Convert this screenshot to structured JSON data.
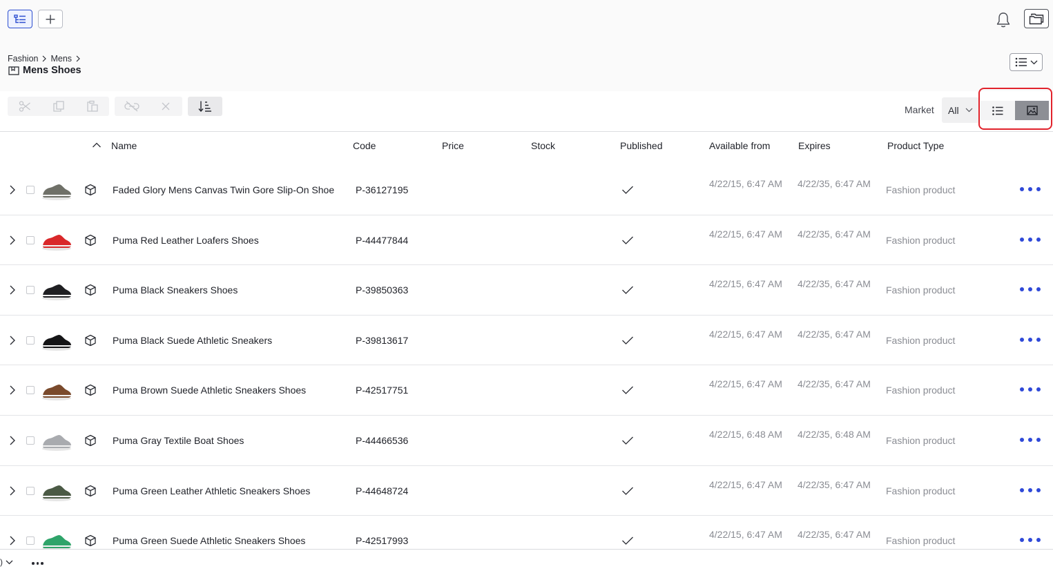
{
  "header": {
    "tree_icon": "hierarchy-tree-icon",
    "add_icon": "plus-icon",
    "bell_icon": "bell-icon",
    "folders_icon": "folders-icon",
    "breadcrumb": [
      "Fashion",
      "Mens"
    ],
    "title": "Mens Shoes",
    "view_menu_icon": "list-view-icon"
  },
  "toolbar": {
    "tools": [
      "scissors-icon",
      "copy-icon",
      "paste-icon",
      "unlink-icon",
      "close-icon",
      "sort-icon"
    ],
    "market_label": "Market",
    "market_value": "All",
    "view_modes": [
      "list-view-icon",
      "image-view-icon"
    ],
    "active_view": "image-view-icon"
  },
  "table": {
    "columns": [
      "Name",
      "Code",
      "Price",
      "Stock",
      "Published",
      "Available from",
      "Expires",
      "Product Type"
    ],
    "sort_column": "Name",
    "sort_direction": "ascending",
    "rows": [
      {
        "name": "Faded Glory Mens Canvas Twin Gore Slip-On Shoe",
        "code": "P-36127195",
        "price": "",
        "stock": "",
        "published": true,
        "available_from": "4/22/15, 6:47 AM",
        "expires": "4/22/35, 6:47 AM",
        "product_type": "Fashion product",
        "shoe_color": "#6f7068"
      },
      {
        "name": "Puma Red Leather Loafers Shoes",
        "code": "P-44477844",
        "price": "",
        "stock": "",
        "published": true,
        "available_from": "4/22/15, 6:47 AM",
        "expires": "4/22/35, 6:47 AM",
        "product_type": "Fashion product",
        "shoe_color": "#d9282a"
      },
      {
        "name": "Puma Black Sneakers Shoes",
        "code": "P-39850363",
        "price": "",
        "stock": "",
        "published": true,
        "available_from": "4/22/15, 6:47 AM",
        "expires": "4/22/35, 6:47 AM",
        "product_type": "Fashion product",
        "shoe_color": "#1f1f22"
      },
      {
        "name": "Puma Black Suede Athletic Sneakers",
        "code": "P-39813617",
        "price": "",
        "stock": "",
        "published": true,
        "available_from": "4/22/15, 6:47 AM",
        "expires": "4/22/35, 6:47 AM",
        "product_type": "Fashion product",
        "shoe_color": "#151517"
      },
      {
        "name": "Puma Brown Suede Athletic Sneakers Shoes",
        "code": "P-42517751",
        "price": "",
        "stock": "",
        "published": true,
        "available_from": "4/22/15, 6:47 AM",
        "expires": "4/22/35, 6:47 AM",
        "product_type": "Fashion product",
        "shoe_color": "#7a4a2c"
      },
      {
        "name": "Puma Gray Textile Boat Shoes",
        "code": "P-44466536",
        "price": "",
        "stock": "",
        "published": true,
        "available_from": "4/22/15, 6:48 AM",
        "expires": "4/22/35, 6:48 AM",
        "product_type": "Fashion product",
        "shoe_color": "#a9abaf"
      },
      {
        "name": "Puma Green Leather Athletic Sneakers Shoes",
        "code": "P-44648724",
        "price": "",
        "stock": "",
        "published": true,
        "available_from": "4/22/15, 6:47 AM",
        "expires": "4/22/35, 6:47 AM",
        "product_type": "Fashion product",
        "shoe_color": "#4b5a45"
      },
      {
        "name": "Puma Green Suede Athletic Sneakers Shoes",
        "code": "P-42517993",
        "price": "",
        "stock": "",
        "published": true,
        "available_from": "4/22/15, 6:47 AM",
        "expires": "4/22/35, 6:47 AM",
        "product_type": "Fashion product",
        "shoe_color": "#2fa46a"
      }
    ]
  },
  "footer": {
    "left_label": ")",
    "more_icon": "more-horizontal-icon"
  }
}
